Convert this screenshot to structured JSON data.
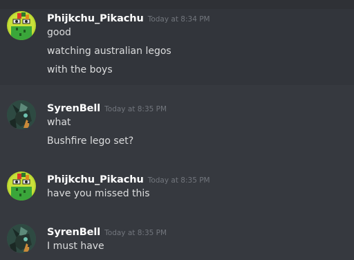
{
  "messages": [
    {
      "username": "Phijkchu_Pikachu",
      "timestamp": "Today at 8:34 PM",
      "avatar": "pikachu-cactus-avatar",
      "lines": [
        "good",
        "watching australian legos",
        "with the boys"
      ]
    },
    {
      "username": "SyrenBell",
      "timestamp": "Today at 8:35 PM",
      "avatar": "changeling-pony-avatar",
      "lines": [
        "what",
        "Bushfire lego set?"
      ]
    },
    {
      "username": "Phijkchu_Pikachu",
      "timestamp": "Today at 8:35 PM",
      "avatar": "pikachu-cactus-avatar",
      "lines": [
        "have you missed this"
      ]
    },
    {
      "username": "SyrenBell",
      "timestamp": "Today at 8:35 PM",
      "avatar": "changeling-pony-avatar",
      "lines": [
        "I must have"
      ]
    }
  ],
  "colors": {
    "background": "#36393f",
    "username": "#ffffff",
    "timestamp": "#72767d",
    "message_text": "#dcddde"
  }
}
